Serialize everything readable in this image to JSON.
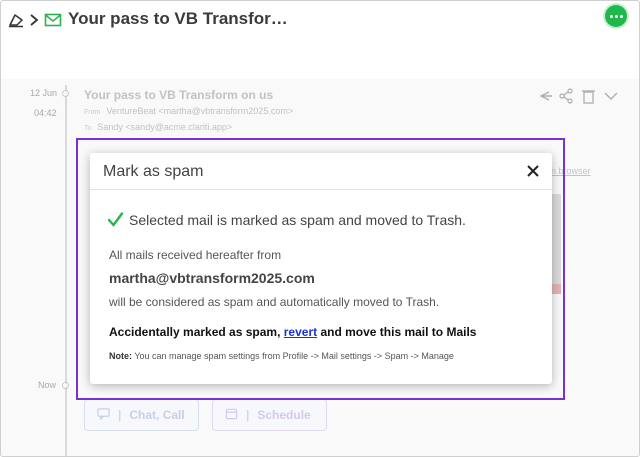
{
  "header": {
    "title": "Your pass to VB Transfor…"
  },
  "timeline": {
    "date": "12 Jun",
    "time": "04:42",
    "now": "Now"
  },
  "email": {
    "subject": "Your pass to VB Transform on us",
    "from_label": "From",
    "from": "VentureBeat <martha@vbtransform2025.com>",
    "to_label": "To",
    "to": "Sandy <sandy@acme.clariti.app>",
    "view_browser": "in browser"
  },
  "bottom_actions": {
    "chat_label": "Chat, Call",
    "schedule_label": "Schedule"
  },
  "modal": {
    "title": "Mark as spam",
    "success": "Selected mail is marked as spam and moved to Trash.",
    "hereafter": "All mails received hereafter from",
    "sender": "martha@vbtransform2025.com",
    "consequence": "will be considered as spam and automatically moved to Trash.",
    "revert_prefix": "Accidentally marked as spam, ",
    "revert_link": "revert",
    "revert_suffix": " and move this mail to Mails",
    "note_label": "Note:",
    "note_text": " You can manage spam settings from Profile -> Mail settings -> Spam -> Manage"
  },
  "colors": {
    "highlight": "#7b2fd6",
    "success": "#2bb24c",
    "link": "#1a32d4",
    "chat": "#1fb84b"
  }
}
